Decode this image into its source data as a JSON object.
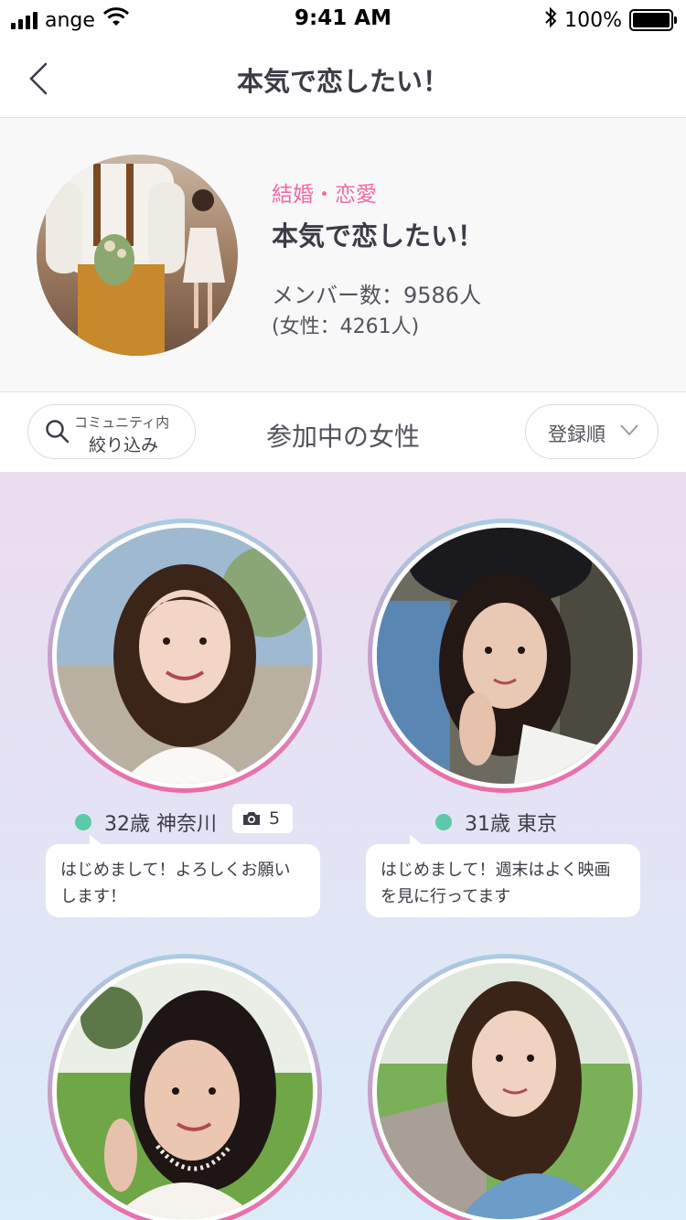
{
  "status_bar": {
    "carrier": "ange",
    "time": "9:41 AM",
    "battery": "100%",
    "icons": [
      "signal-icon",
      "wifi-icon",
      "bluetooth-icon",
      "battery-icon"
    ]
  },
  "nav": {
    "back_icon": "chevron-left-icon",
    "title": "本気で恋したい！"
  },
  "community": {
    "category": "結婚・恋愛",
    "name": "本気で恋したい！",
    "members": "メンバー数：9586人",
    "female_count": "(女性：4261人)"
  },
  "filter_bar": {
    "search_line1": "コミュニティ内",
    "search_line2": "絞り込み",
    "section_title": "参加中の女性",
    "sort_label": "登録順"
  },
  "members": [
    {
      "age_location": "32歳 神奈川",
      "online": true,
      "photo_count": "5",
      "message": "はじめまして！よろしくお願いします！"
    },
    {
      "age_location": "31歳 東京",
      "online": true,
      "photo_count": null,
      "message": "はじめまして！週末はよく映画を見に行ってます"
    },
    {
      "age_location": "",
      "online": false,
      "photo_count": null,
      "message": ""
    },
    {
      "age_location": "",
      "online": false,
      "photo_count": null,
      "message": ""
    }
  ],
  "colors": {
    "accent_pink": "#ef6aa5",
    "online_green": "#5ccaa8",
    "text_dark": "#3e3a46",
    "ring_top": "#a9cce2",
    "ring_bottom": "#ee6aa6"
  }
}
